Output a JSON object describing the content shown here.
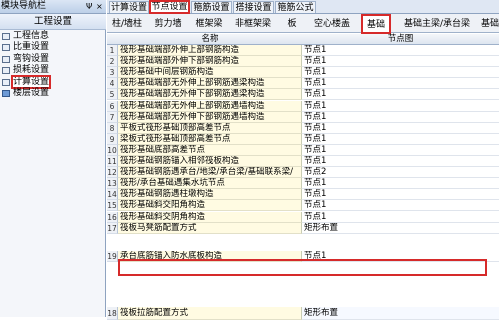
{
  "nav": {
    "title": "模块导航栏",
    "pin_glyph": "Ψ",
    "close_glyph": "×",
    "group": "工程设置",
    "items": [
      {
        "label": "工程信息"
      },
      {
        "label": "比重设置"
      },
      {
        "label": "弯钩设置"
      },
      {
        "label": "损耗设置"
      },
      {
        "label": "计算设置"
      },
      {
        "label": "楼层设置"
      }
    ]
  },
  "top_tabs": [
    {
      "label": "计算设置"
    },
    {
      "label": "节点设置"
    },
    {
      "label": "箍筋设置"
    },
    {
      "label": "搭接设置"
    },
    {
      "label": "箍筋公式"
    }
  ],
  "sub_tabs": [
    {
      "label": "柱/墙柱"
    },
    {
      "label": "剪力墙"
    },
    {
      "label": "框架梁"
    },
    {
      "label": "非框架梁"
    },
    {
      "label": "板"
    },
    {
      "label": "空心楼盖"
    },
    {
      "label": "基础"
    },
    {
      "label": "基础主梁/承台梁"
    },
    {
      "label": "基础次"
    }
  ],
  "grid": {
    "col_name": "名称",
    "col_value": "节点图",
    "rows": [
      {
        "num": "1",
        "name": "筏形基础端部外伸上部钢筋构造",
        "value": "节点1"
      },
      {
        "num": "2",
        "name": "筏形基础端部外伸下部钢筋构造",
        "value": "节点1"
      },
      {
        "num": "3",
        "name": "筏形基础中间层钢筋构造",
        "value": "节点1"
      },
      {
        "num": "4",
        "name": "筏形基础端部无外伸上部钢筋遇梁构造",
        "value": "节点1"
      },
      {
        "num": "5",
        "name": "筏形基础端部无外伸下部钢筋遇梁构造",
        "value": "节点1"
      },
      {
        "num": "6",
        "name": "筏形基础端部无外伸上部钢筋遇墙构造",
        "value": "节点1"
      },
      {
        "num": "7",
        "name": "筏形基础端部无外伸下部钢筋遇墙构造",
        "value": "节点1"
      },
      {
        "num": "8",
        "name": "平板式筏形基础顶部高差节点",
        "value": "节点1"
      },
      {
        "num": "9",
        "name": "梁板式筏形基础顶部高差节点",
        "value": "节点1"
      },
      {
        "num": "10",
        "name": "筏形基础底部高差节点",
        "value": "节点1"
      },
      {
        "num": "11",
        "name": "筏形基础钢筋锚入相邻筏板构造",
        "value": "节点1"
      },
      {
        "num": "12",
        "name": "筏形基础钢筋遇承台/地梁/承台梁/基础联系梁/",
        "value": "节点2"
      },
      {
        "num": "13",
        "name": "筏形/承台基础遇集水坑节点",
        "value": "节点1"
      },
      {
        "num": "14",
        "name": "筏形基础钢筋遇柱墩构造",
        "value": "节点1"
      },
      {
        "num": "15",
        "name": "筏形基础斜交阳角构造",
        "value": "节点1"
      },
      {
        "num": "16",
        "name": "筏形基础斜交阴角构造",
        "value": "节点1"
      },
      {
        "num": "17",
        "name": "筏板马凳筋配置方式",
        "value": "矩形布置"
      },
      {
        "num": "18",
        "name": "筏板拉筋配置方式",
        "value": "矩形布置"
      },
      {
        "num": "19",
        "name": "承台底筋锚入防水底板构造",
        "value": "节点1"
      }
    ]
  },
  "colors": {
    "highlight": "#d62a2a",
    "name_cell_bg": "#fffbe2"
  }
}
